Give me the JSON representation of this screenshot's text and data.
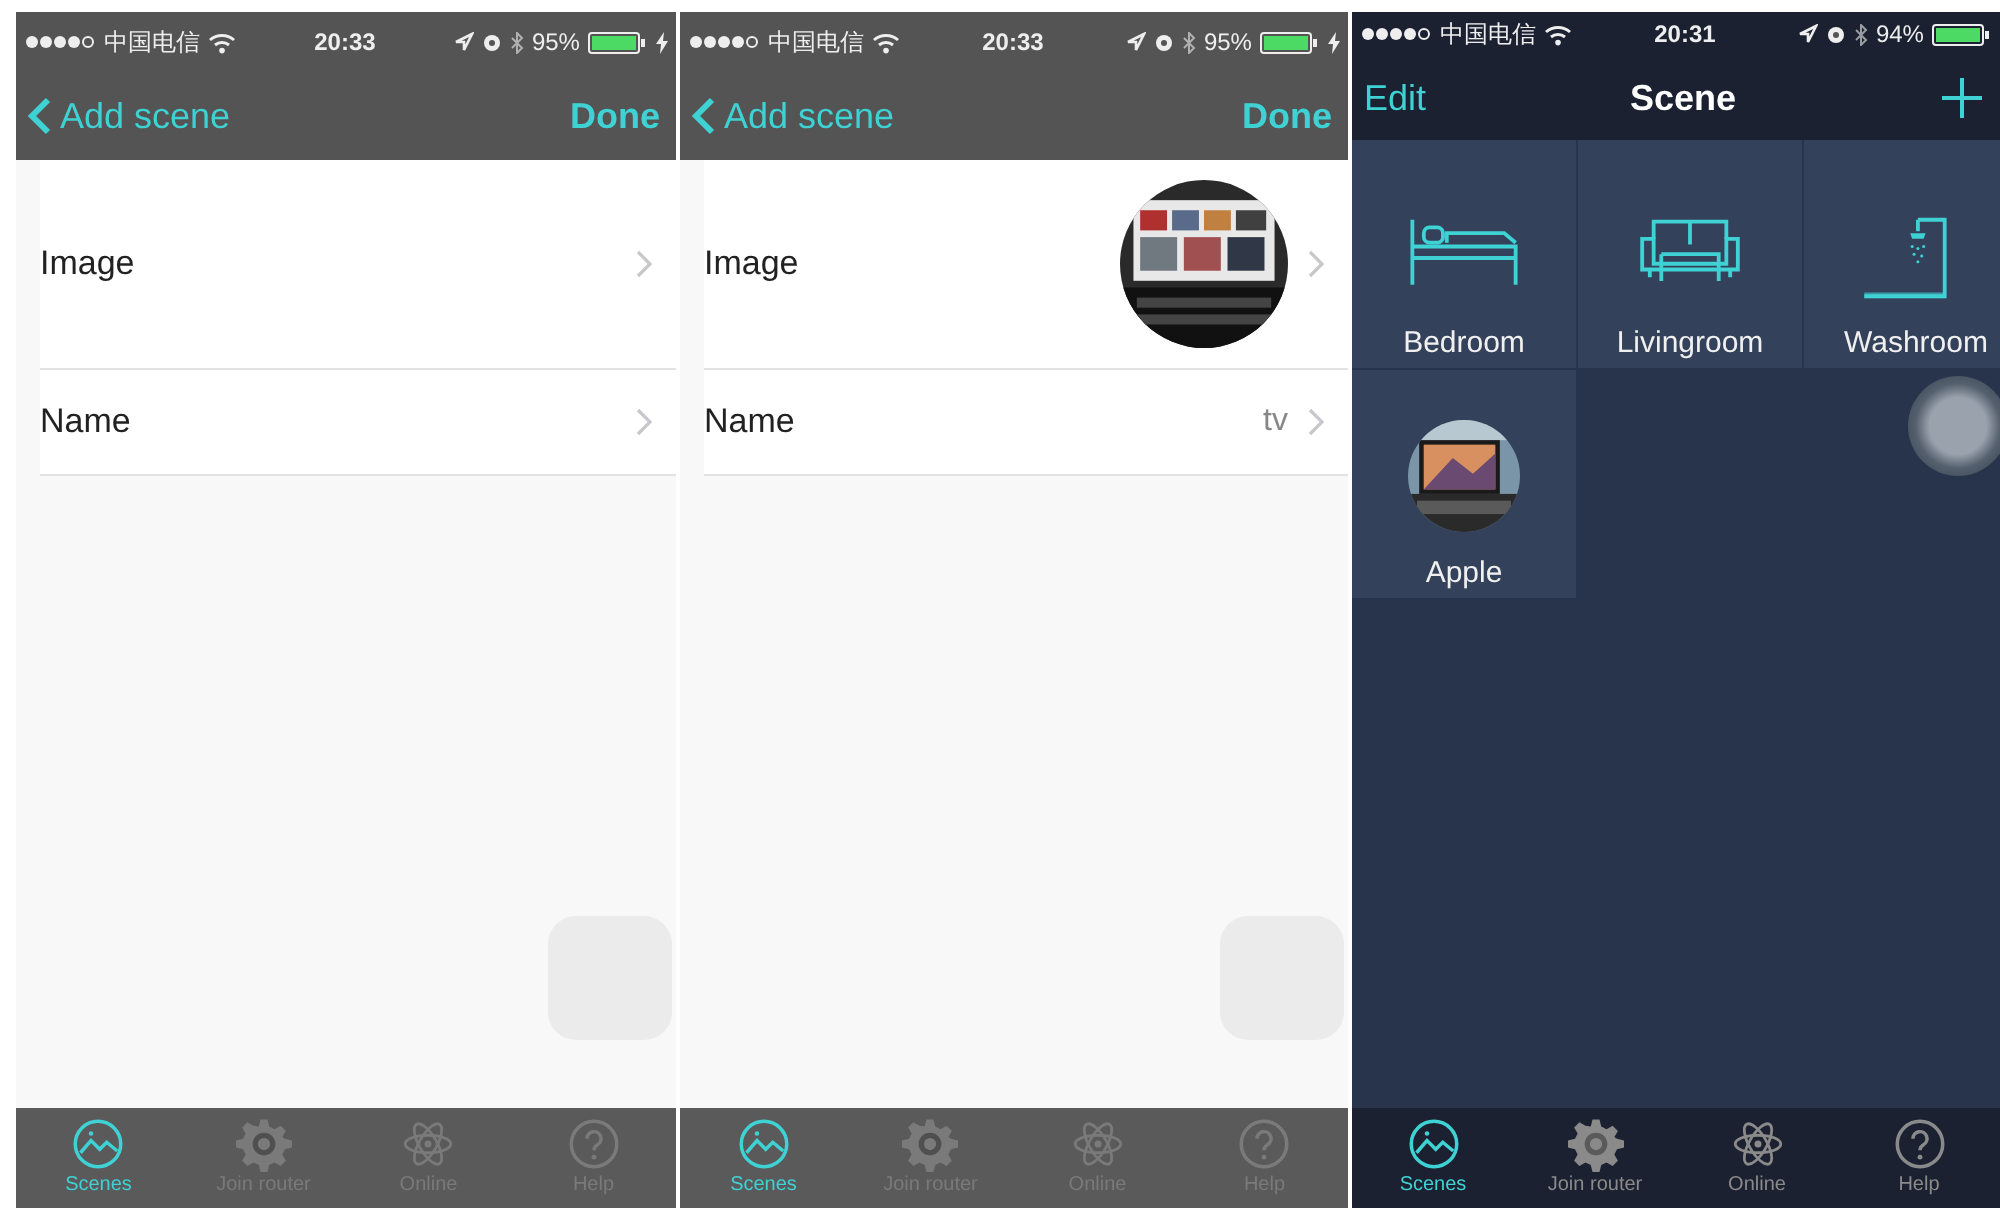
{
  "screens": [
    {
      "kind": "form",
      "status_bar": {
        "carrier": "中国电信",
        "time": "20:33",
        "battery": "95%",
        "charging": true
      },
      "nav": {
        "back": "Add scene",
        "action": "Done"
      },
      "rows": [
        {
          "label": "Image",
          "image_set": false
        },
        {
          "label": "Name",
          "kind": "text"
        }
      ],
      "assistive_touch": true,
      "tab_bar": [
        {
          "label": "Scenes",
          "selected": true
        },
        {
          "label": "Join router",
          "selected": false
        },
        {
          "label": "Online",
          "selected": false
        },
        {
          "label": "Help",
          "selected": false
        }
      ]
    },
    {
      "kind": "form",
      "status_bar": {
        "carrier": "中国电信",
        "time": "20:33",
        "battery": "95%",
        "charging": true
      },
      "nav": {
        "back": "Add scene",
        "action": "Done"
      },
      "rows": [
        {
          "label": "Image",
          "image_set": true
        },
        {
          "label": "Name",
          "kind": "text",
          "value": "tv"
        }
      ],
      "assistive_touch": true,
      "tab_bar": [
        {
          "label": "Scenes",
          "selected": true
        },
        {
          "label": "Join router",
          "selected": false
        },
        {
          "label": "Online",
          "selected": false
        },
        {
          "label": "Help",
          "selected": false
        }
      ]
    },
    {
      "kind": "grid",
      "status_bar": {
        "carrier": "中国电信",
        "time": "20:31",
        "battery": "94%",
        "charging": false
      },
      "nav": {
        "edit": "Edit",
        "title": "Scene"
      },
      "tiles": [
        {
          "label": "Bedroom",
          "kind": "bed"
        },
        {
          "label": "Livingroom",
          "kind": "sofa"
        },
        {
          "label": "Washroom",
          "kind": "shower"
        },
        {
          "label": "Apple",
          "kind": "picture"
        }
      ],
      "assistive_touch": true,
      "tab_bar": [
        {
          "label": "Scenes",
          "selected": true
        },
        {
          "label": "Join router",
          "selected": false
        },
        {
          "label": "Online",
          "selected": false
        },
        {
          "label": "Help",
          "selected": false
        }
      ]
    }
  ]
}
